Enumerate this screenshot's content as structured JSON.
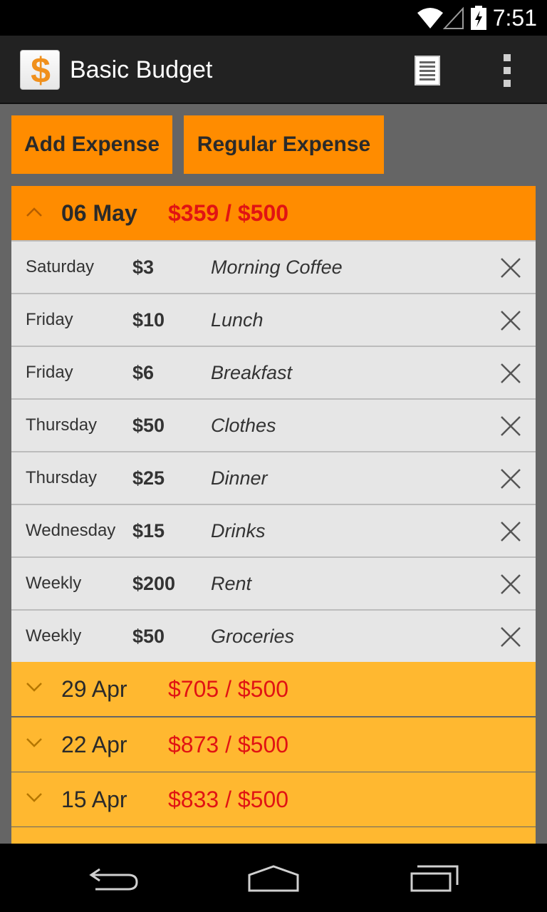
{
  "status_bar": {
    "time": "7:51",
    "icons": [
      "wifi-icon",
      "no-signal-icon",
      "battery-charging-icon"
    ]
  },
  "action_bar": {
    "app_icon": "dollar-icon",
    "app_icon_glyph": "$",
    "title": "Basic Budget",
    "actions": [
      "list-view-icon",
      "overflow-menu-icon"
    ]
  },
  "buttons": {
    "add_expense": "Add Expense",
    "regular_expense": "Regular Expense"
  },
  "current_week": {
    "date": "06 May",
    "total": "$359 / $500",
    "expanded": true,
    "expenses": [
      {
        "day": "Saturday",
        "amount": "$3",
        "description": "Morning Coffee"
      },
      {
        "day": "Friday",
        "amount": "$10",
        "description": "Lunch"
      },
      {
        "day": "Friday",
        "amount": "$6",
        "description": "Breakfast"
      },
      {
        "day": "Thursday",
        "amount": "$50",
        "description": "Clothes"
      },
      {
        "day": "Thursday",
        "amount": "$25",
        "description": "Dinner"
      },
      {
        "day": "Wednesday",
        "amount": "$15",
        "description": "Drinks"
      },
      {
        "day": "Weekly",
        "amount": "$200",
        "description": "Rent"
      },
      {
        "day": "Weekly",
        "amount": "$50",
        "description": "Groceries"
      }
    ]
  },
  "past_weeks": [
    {
      "date": "29 Apr",
      "total": "$705 / $500"
    },
    {
      "date": "22 Apr",
      "total": "$873 / $500"
    },
    {
      "date": "15 Apr",
      "total": "$833 / $500"
    }
  ],
  "colors": {
    "accent": "#ff8c00",
    "collapsed_week": "#ffb830",
    "over_budget_text": "#e11313",
    "row_background": "#e6e6e6",
    "content_background": "#656565"
  },
  "nav_bar": [
    "back-icon",
    "home-icon",
    "recent-apps-icon"
  ]
}
